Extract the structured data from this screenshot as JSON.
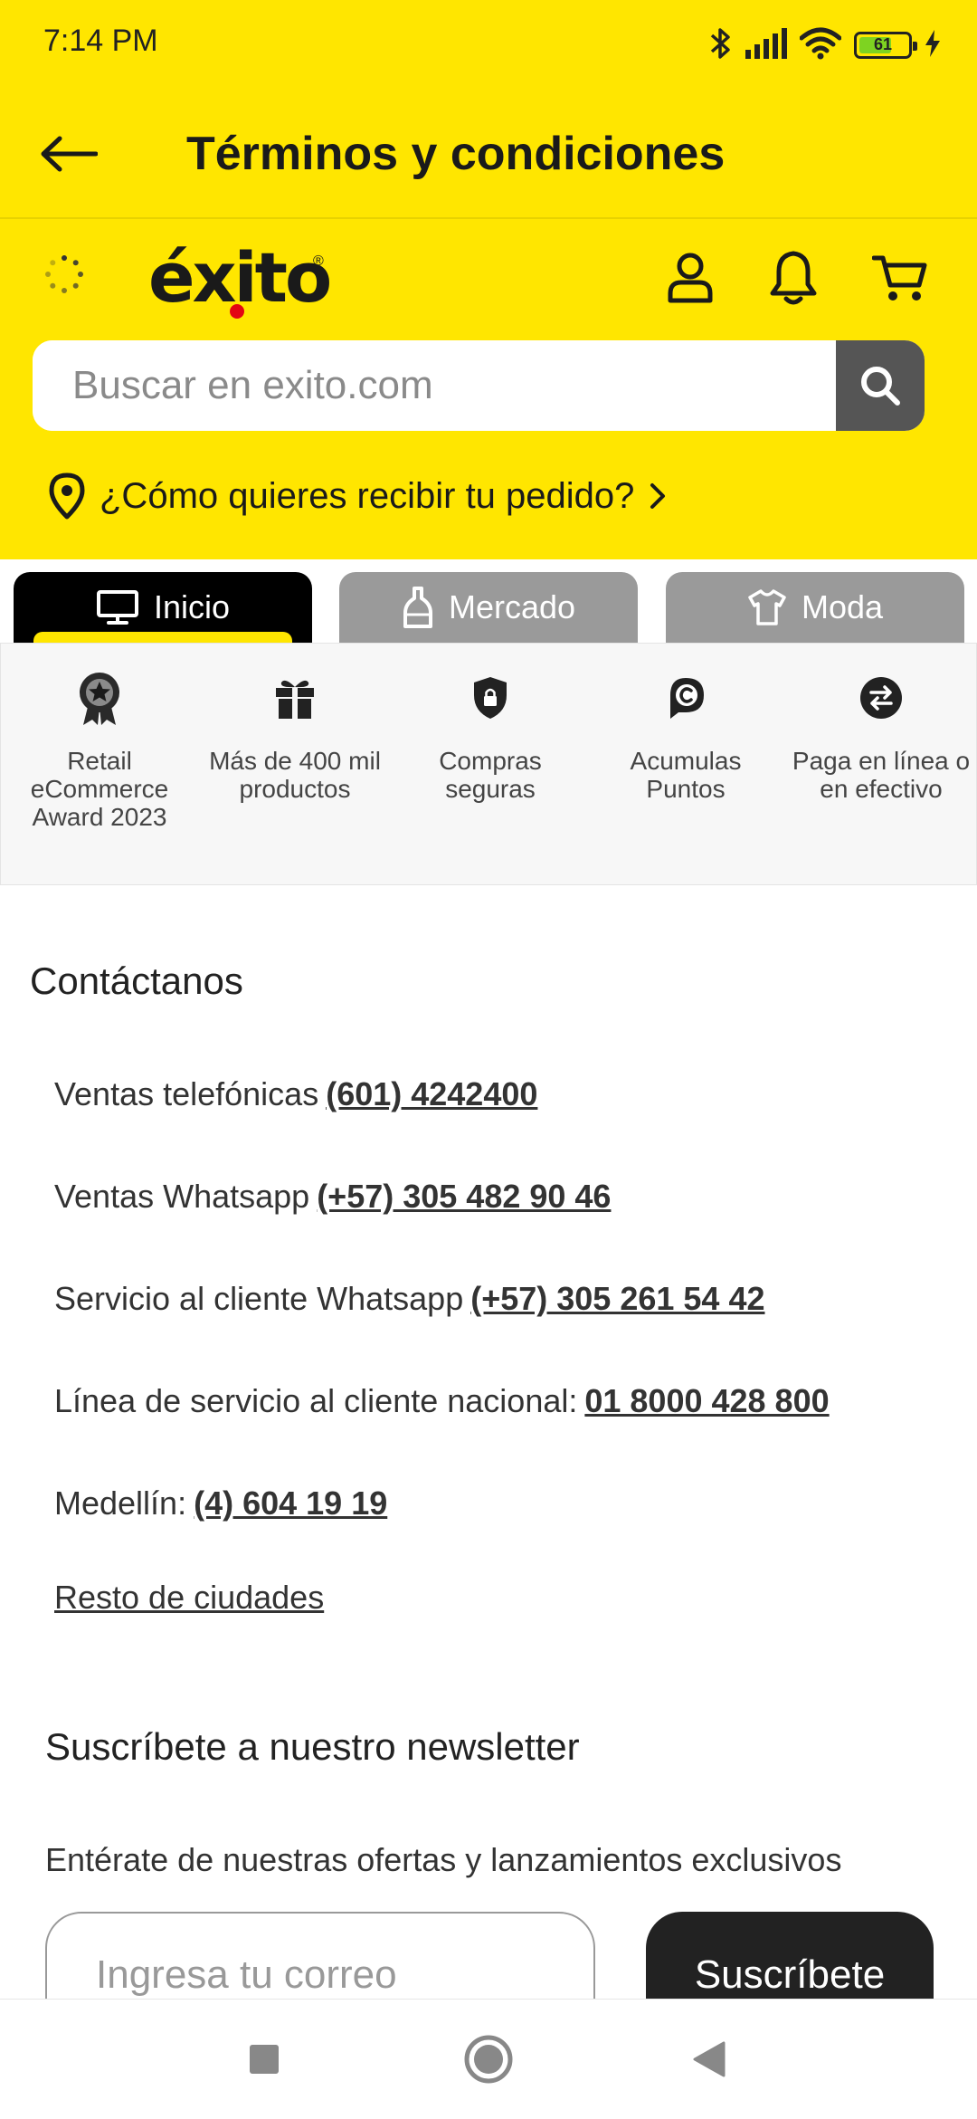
{
  "status_bar": {
    "time": "7:14 PM",
    "battery": "61",
    "icons": [
      "bluetooth-icon",
      "signal-icon",
      "wifi-icon",
      "battery-icon",
      "charging-icon"
    ]
  },
  "app_bar": {
    "title": "Términos y condiciones",
    "back_icon": "arrow-left-icon"
  },
  "header": {
    "logo_text": "éxito",
    "logo_reg": "®",
    "search": {
      "placeholder": "Buscar en exito.com"
    },
    "delivery": "¿Cómo quieres recibir tu pedido?",
    "icons": [
      "user-icon",
      "bell-icon",
      "cart-icon"
    ]
  },
  "tabs": [
    {
      "label": "Inicio",
      "icon": "monitor-icon",
      "active": true
    },
    {
      "label": "Mercado",
      "icon": "bottle-icon",
      "active": false
    },
    {
      "label": "Moda",
      "icon": "shirt-icon",
      "active": false
    }
  ],
  "benefits": [
    {
      "label": "Retail\neCommerce\nAward 2023",
      "icon": "award-icon"
    },
    {
      "label": "Más de 400 mil\nproductos",
      "icon": "gift-icon"
    },
    {
      "label": "Compras\nseguras",
      "icon": "shield-lock-icon"
    },
    {
      "label": "Acumulas\nPuntos",
      "icon": "points-icon"
    },
    {
      "label": "Paga en línea o\nen efectivo",
      "icon": "exchange-icon"
    }
  ],
  "contact": {
    "title": "Contáctanos",
    "lines": [
      {
        "label": "Ventas telefónicas",
        "number": "(601) 4242400"
      },
      {
        "label": "Ventas Whatsapp",
        "number": "(+57) 305 482 90 46"
      },
      {
        "label": "Servicio al cliente Whatsapp",
        "number": "(+57) 305 261 54 42"
      },
      {
        "label": "Línea de servicio al cliente nacional:",
        "number": "01 8000 428 800"
      },
      {
        "label": "Medellín:",
        "number": "(4) 604 19 19"
      }
    ],
    "rest_link": "Resto de ciudades"
  },
  "newsletter": {
    "title": "Suscríbete a nuestro newsletter",
    "subtitle": "Entérate de nuestras ofertas y lanzamientos exclusivos",
    "email_placeholder": "Ingresa tu correo",
    "button": "Suscríbete"
  },
  "colors": {
    "brand_yellow": "#FFE600",
    "dark": "#222222",
    "tab_gray": "#9A9A9A",
    "logo_dot": "#E30613"
  }
}
